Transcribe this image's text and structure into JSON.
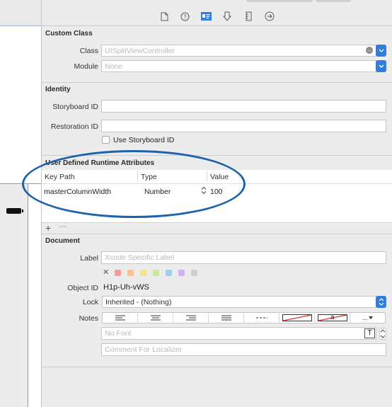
{
  "inspector": {
    "tabs": [
      {
        "name": "file-inspector-icon",
        "glyph": "doc"
      },
      {
        "name": "quick-help-icon",
        "glyph": "?"
      },
      {
        "name": "identity-inspector-icon",
        "glyph": "id"
      },
      {
        "name": "attributes-inspector-icon",
        "glyph": "attr"
      },
      {
        "name": "size-inspector-icon",
        "glyph": "size"
      },
      {
        "name": "connections-inspector-icon",
        "glyph": "conn"
      }
    ]
  },
  "custom_class": {
    "title": "Custom Class",
    "class_label": "Class",
    "class_placeholder": "UISplitViewController",
    "module_label": "Module",
    "module_placeholder": "None"
  },
  "identity": {
    "title": "Identity",
    "storyboard_id_label": "Storyboard ID",
    "storyboard_id_value": "",
    "restoration_id_label": "Restoration ID",
    "restoration_id_value": "",
    "use_storyboard_id_label": "Use Storyboard ID",
    "use_storyboard_id_checked": false
  },
  "runtime_attributes": {
    "title": "User Defined Runtime Attributes",
    "columns": [
      "Key Path",
      "Type",
      "Value"
    ],
    "rows": [
      {
        "key_path": "masterColumnWidth",
        "type": "Number",
        "value": "100"
      }
    ],
    "add_label": "+",
    "remove_label": "—"
  },
  "document": {
    "title": "Document",
    "label_label": "Label",
    "label_placeholder": "Xcode Specific Label",
    "clear_color_glyph": "✕",
    "label_colors": [
      "#f29b9b",
      "#f7c38f",
      "#f4e58a",
      "#c8e89a",
      "#9fcdf2",
      "#d8b0ee",
      "#cfcfcf"
    ],
    "object_id_label": "Object ID",
    "object_id_value": "H1p-Uh-vWS",
    "lock_label": "Lock",
    "lock_value": "Inherited - (Nothing)",
    "notes_label": "Notes",
    "font_placeholder": "No Font",
    "comment_placeholder": "Comment For Localizer",
    "format_segments": [
      "left",
      "center",
      "right",
      "justify",
      "---",
      "strike",
      "a",
      "..."
    ],
    "more_label": "...",
    "letter_label": "a"
  },
  "colors": {
    "accent": "#2f7dde",
    "annotation": "#1c63ad"
  }
}
